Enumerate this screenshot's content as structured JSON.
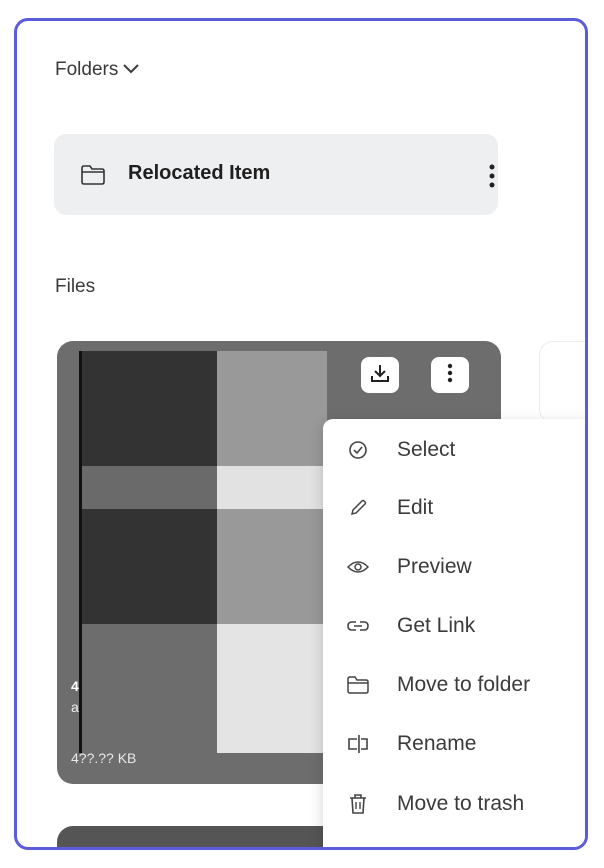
{
  "folders": {
    "label": "Folders",
    "items": [
      {
        "name": "Relocated Item"
      }
    ]
  },
  "files": {
    "label": "Files",
    "items": [
      {
        "title_fragment": "4",
        "subtitle_fragment": "a",
        "size": "4??.?? KB"
      }
    ]
  },
  "context_menu": {
    "items": [
      {
        "label": "Select",
        "icon": "check-circle-icon"
      },
      {
        "label": "Edit",
        "icon": "pencil-icon"
      },
      {
        "label": "Preview",
        "icon": "eye-icon"
      },
      {
        "label": "Get Link",
        "icon": "link-icon"
      },
      {
        "label": "Move to folder",
        "icon": "folder-icon"
      },
      {
        "label": "Rename",
        "icon": "rename-icon"
      },
      {
        "label": "Move to trash",
        "icon": "trash-icon"
      }
    ]
  },
  "colors": {
    "frame_border": "#5b5bdc",
    "folder_bg": "#eeeff1",
    "file_card_bg": "#6d6d6d"
  }
}
